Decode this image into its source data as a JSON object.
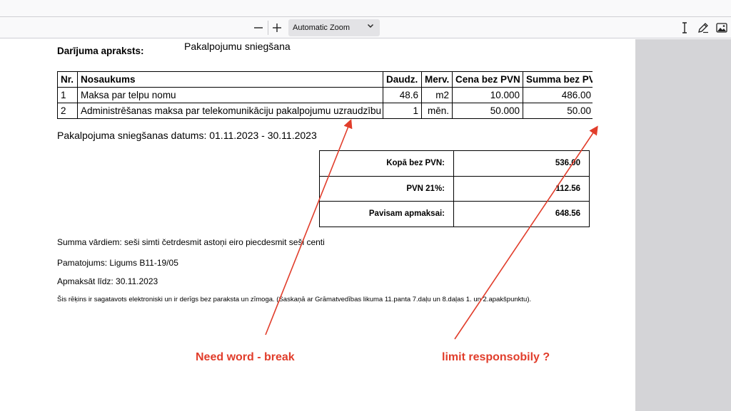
{
  "toolbar": {
    "zoom_out_symbol": "—",
    "zoom_in_symbol": "+",
    "zoom_value": "Automatic Zoom",
    "icons": [
      "zoom-out-icon",
      "zoom-in-icon",
      "chevron-down-icon",
      "text-cursor-icon",
      "pencil-icon",
      "image-icon"
    ]
  },
  "document": {
    "description_label": "Darījuma apraksts:",
    "description_value": "Pakalpojumu sniegšana",
    "table": {
      "headers": [
        "Nr.",
        "Nosaukums",
        "Daudz.",
        "Merv.",
        "Cena bez PVN",
        "Summa bez PVN"
      ],
      "rows": [
        [
          "1",
          "Maksa par telpu nomu",
          "48.6",
          "m2",
          "10.000",
          "486.00"
        ],
        [
          "2",
          "Administrēšanas maksa par telekomunikāciju pakalpojumu uzraudzību",
          "1",
          "mēn.",
          "50.000",
          "50.00"
        ]
      ]
    },
    "service_date": "Pakalpojuma sniegšanas datums: 01.11.2023 - 30.11.2023",
    "totals": [
      {
        "label": "Kopā bez PVN:",
        "value": "536.00"
      },
      {
        "label": "PVN 21%:",
        "value": "112.56"
      },
      {
        "label": "Pavisam apmaksai:",
        "value": "648.56"
      }
    ],
    "amount_words": "Summa vārdiem: seši simti četrdesmit astoņi eiro piecdesmit seši centi",
    "basis": "Pamatojums: Ligums B11-19/05",
    "pay_by": "Apmaksāt līdz: 30.11.2023",
    "footnote": "Šis rēķins ir sagatavots elektroniski un ir derīgs bez paraksta un zīmoga. (Saskaņā ar Grāmatvedības likuma 11.panta 7.daļu un 8.daļas 1. un 2.apakšpunktu)."
  },
  "annotations": {
    "left": "Need word - break",
    "right": "limit responsobily ?",
    "color": "#e13d2b"
  }
}
